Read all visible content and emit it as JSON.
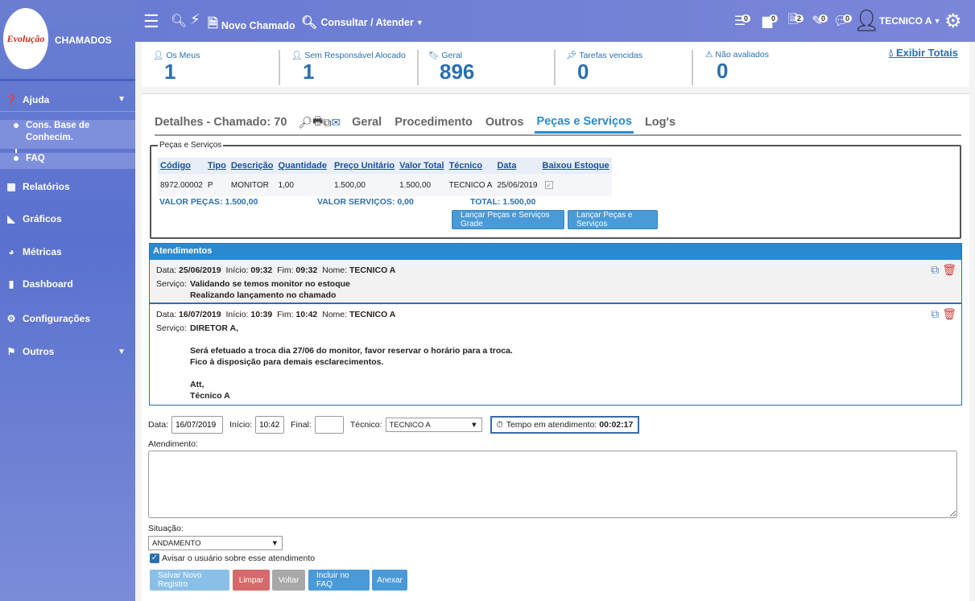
{
  "app": {
    "logo_text": "Evolução",
    "title": "CHAMADOS"
  },
  "sidebar": {
    "items": [
      {
        "label": "Ajuda",
        "icon": "question-circle-icon"
      },
      {
        "label": "Relatórios",
        "icon": "table-icon"
      },
      {
        "label": "Gráficos",
        "icon": "area-chart-icon"
      },
      {
        "label": "Métricas",
        "icon": "pie-chart-icon"
      },
      {
        "label": "Dashboard",
        "icon": "bar-chart-icon"
      },
      {
        "label": "Configurações",
        "icon": "cogs-icon"
      },
      {
        "label": "Outros",
        "icon": "flag-icon"
      }
    ],
    "sub_items": [
      "Cons. Base de Conhecim.",
      "FAQ"
    ]
  },
  "topbar": {
    "novo_chamado": "Novo Chamado",
    "consultar": "Consultar / Atender",
    "badges": [
      "0",
      "0",
      "2",
      "0",
      "0"
    ],
    "user": "TECNICO A"
  },
  "stats": [
    {
      "label": "Os Meus",
      "value": "1"
    },
    {
      "label": "Sem Responsável Alocado",
      "value": "1"
    },
    {
      "label": "Geral",
      "value": "896"
    },
    {
      "label": "Tarefas vencidas",
      "value": "0"
    },
    {
      "label": "Não avaliados",
      "value": "0"
    }
  ],
  "exibir_totais": "Exibir Totais",
  "tabs": {
    "title": "Detalhes - Chamado: 70",
    "items": [
      "Geral",
      "Procedimento",
      "Outros",
      "Peças e Serviços",
      "Log's"
    ],
    "active": "Peças e Serviços"
  },
  "pecas": {
    "legend": "Peças e Serviços",
    "headers": [
      "Código",
      "Tipo",
      "Descrição",
      "Quantidade",
      "Preço Unitário",
      "Valor Total",
      "Técnico",
      "Data",
      "Baixou Estoque"
    ],
    "rows": [
      [
        "8972.00002",
        "P",
        "MONITOR",
        "1,00",
        "1.500,00",
        "1.500,00",
        "TECNICO A",
        "25/06/2019"
      ]
    ],
    "valor_pecas": "VALOR PEÇAS: 1.500,00",
    "valor_servicos": "VALOR SERVIÇOS: 0,00",
    "total": "TOTAL: 1.500,00",
    "btn_grade": "Lançar Peças e Serviços Grade",
    "btn_lancar": "Lançar Peças e Serviços"
  },
  "atendimentos": {
    "header": "Atendimentos",
    "labels": {
      "data": "Data:",
      "inicio": "Início:",
      "fim": "Fim:",
      "nome": "Nome:",
      "servico": "Serviço:"
    },
    "entries": [
      {
        "data": "25/06/2019",
        "inicio": "09:32",
        "fim": "09:32",
        "nome": "TECNICO A",
        "servico": [
          "Validando se temos monitor no estoque",
          "Realizando lançamento no chamado"
        ]
      },
      {
        "data": "16/07/2019",
        "inicio": "10:39",
        "fim": "10:42",
        "nome": "TECNICO A",
        "servico": [
          "DIRETOR A,",
          "",
          "Será efetuado a troca dia 27/06 do monitor, favor reservar o horário para a troca.",
          "Fico à disposição para demais esclarecimentos.",
          "",
          "Att,",
          "Técnico A"
        ]
      }
    ]
  },
  "form": {
    "data_label": "Data:",
    "data_value": "16/07/2019",
    "inicio_label": "Início:",
    "inicio_value": "10:42",
    "final_label": "Final:",
    "final_value": "",
    "tecnico_label": "Técnico:",
    "tecnico_value": "TECNICO A",
    "tempo_label": "Tempo em atendimento:",
    "tempo_value": "00:02:17",
    "atendimento_label": "Atendimento:",
    "situacao_label": "Situação:",
    "situacao_value": "ANDAMENTO",
    "avisar_label": "Avisar o usuário sobre esse atendimento",
    "buttons": [
      "Salvar Novo Registro",
      "Limpar",
      "Voltar",
      "Incluir no FAQ",
      "Anexar"
    ]
  },
  "colors": {
    "accent": "#2a8ad0",
    "sidebar": "#6a7fd2",
    "danger": "#d46a6a",
    "muted": "#a8a8a8"
  }
}
